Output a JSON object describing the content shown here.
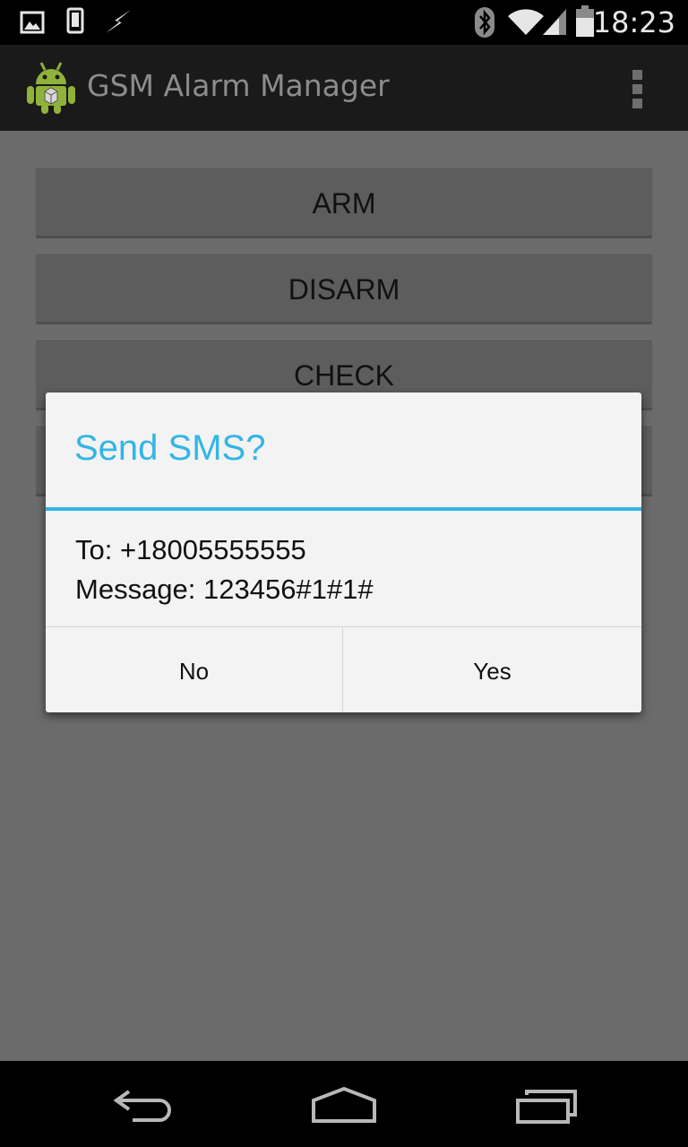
{
  "status_bar": {
    "time": "18:23",
    "icons": [
      "gallery-icon",
      "phone-icon",
      "usb-debug-icon",
      "bluetooth-icon",
      "wifi-icon",
      "signal-icon",
      "battery-icon"
    ]
  },
  "action_bar": {
    "title": "GSM Alarm Manager",
    "app_icon": "android-robot-icon",
    "overflow_icon": "overflow-menu-icon"
  },
  "buttons": [
    {
      "label": "ARM"
    },
    {
      "label": "DISARM"
    },
    {
      "label": "CHECK"
    }
  ],
  "dialog": {
    "title": "Send SMS?",
    "to_line": "To: +18005555555",
    "message_line": "Message: 123456#1#1#",
    "no_label": "No",
    "yes_label": "Yes"
  },
  "nav_bar": {
    "icons": [
      "back-icon",
      "home-icon",
      "recents-icon"
    ]
  },
  "colors": {
    "accent": "#33b5e5",
    "dim_background": "#6b6b6b"
  }
}
